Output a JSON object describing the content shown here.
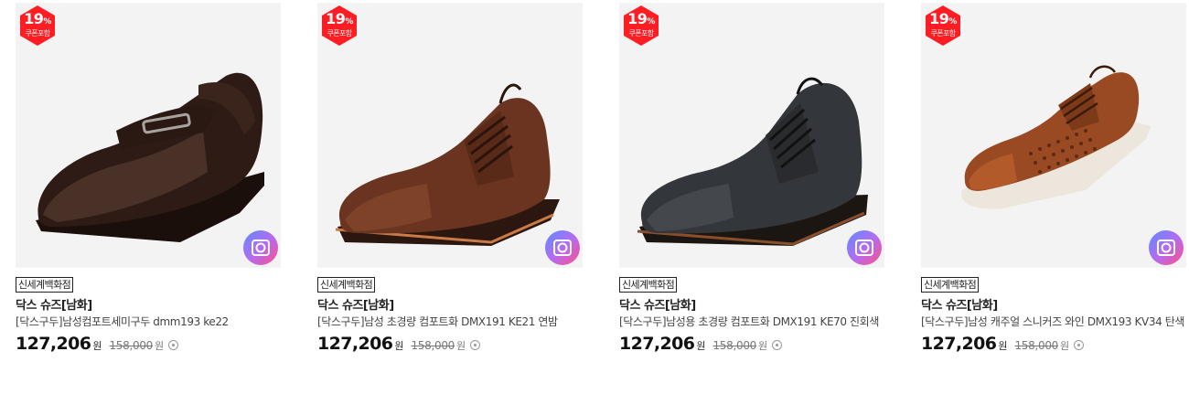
{
  "colors": {
    "badge": "#ff1d24",
    "price": "#111111",
    "original_price": "#777777"
  },
  "products": [
    {
      "discount": "19",
      "discount_unit": "%",
      "coupon": "쿠폰포함",
      "store": "신세계백화점",
      "brand": "닥스 슈즈[남화]",
      "name": "[닥스구두]남성컴포트세미구두 dmm193 ke22",
      "price": "127,206",
      "price_unit": "원",
      "original_price": "158,000",
      "original_unit": "원",
      "image_icon": "camera-icon",
      "shoe_color": "#2e1b15"
    },
    {
      "discount": "19",
      "discount_unit": "%",
      "coupon": "쿠폰포함",
      "store": "신세계백화점",
      "brand": "닥스 슈즈[남화]",
      "name": "[닥스구두]남성 초경량 컴포트화 DMX191 KE21 연밤",
      "price": "127,206",
      "price_unit": "원",
      "original_price": "158,000",
      "original_unit": "원",
      "image_icon": "camera-icon",
      "shoe_color": "#6b3420"
    },
    {
      "discount": "19",
      "discount_unit": "%",
      "coupon": "쿠폰포함",
      "store": "신세계백화점",
      "brand": "닥스 슈즈[남화]",
      "name": "[닥스구두]남성용 초경량 컴포트화 DMX191 KE70 진회색",
      "price": "127,206",
      "price_unit": "원",
      "original_price": "158,000",
      "original_unit": "원",
      "image_icon": "camera-icon",
      "shoe_color": "#33363a"
    },
    {
      "discount": "19",
      "discount_unit": "%",
      "coupon": "쿠폰포함",
      "store": "신세계백화점",
      "brand": "닥스 슈즈[남화]",
      "name": "[닥스구두]남성 캐주얼 스니커즈 와인 DMX193 KV34 탄색",
      "price": "127,206",
      "price_unit": "원",
      "original_price": "158,000",
      "original_unit": "원",
      "image_icon": "camera-icon",
      "shoe_color": "#9a4a22"
    }
  ]
}
